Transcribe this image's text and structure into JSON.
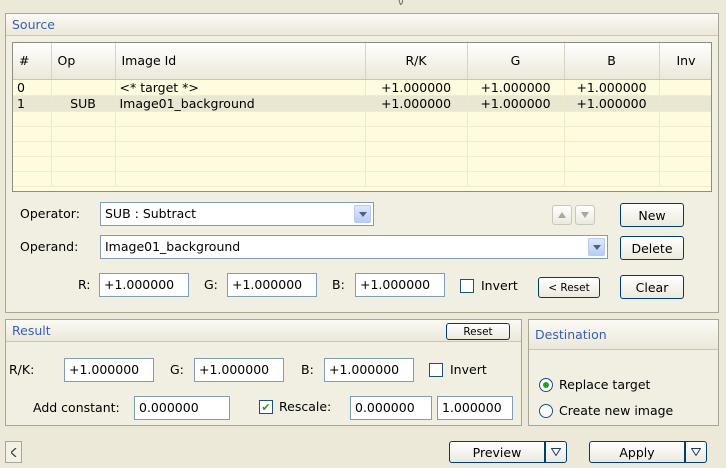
{
  "source": {
    "title": "Source",
    "columns": [
      "#",
      "Op",
      "Image Id",
      "R/K",
      "G",
      "B",
      "Inv"
    ],
    "rows": [
      {
        "num": "0",
        "op": "",
        "image_id": "<* target *>",
        "rk": "+1.000000",
        "g": "+1.000000",
        "b": "+1.000000",
        "inv": ""
      },
      {
        "num": "1",
        "op": "SUB",
        "image_id": "Image01_background",
        "rk": "+1.000000",
        "g": "+1.000000",
        "b": "+1.000000",
        "inv": ""
      }
    ],
    "operator_label": "Operator:",
    "operator_value": "SUB : Subtract",
    "operand_label": "Operand:",
    "operand_value": "Image01_background",
    "r_label": "R:",
    "r_value": "+1.000000",
    "g_label": "G:",
    "g_value": "+1.000000",
    "b_label": "B:",
    "b_value": "+1.000000",
    "invert_label": "Invert",
    "invert_checked": false,
    "reset_label": "< Reset",
    "new_label": "New",
    "delete_label": "Delete",
    "clear_label": "Clear",
    "up_icon": "arrow-up-icon",
    "down_icon": "arrow-down-icon"
  },
  "result": {
    "title": "Result",
    "reset_label": "Reset",
    "rk_label": "R/K:",
    "rk_value": "+1.000000",
    "g_label": "G:",
    "g_value": "+1.000000",
    "b_label": "B:",
    "b_value": "+1.000000",
    "invert_label": "Invert",
    "invert_checked": false,
    "add_constant_label": "Add constant:",
    "add_constant_value": "0.000000",
    "rescale_label": "Rescale:",
    "rescale_checked": true,
    "rescale_min": "0.000000",
    "rescale_max": "1.000000"
  },
  "destination": {
    "title": "Destination",
    "options": [
      "Replace target",
      "Create new image"
    ],
    "selected": "Replace target"
  },
  "footer": {
    "left_icon": "chevron-left-icon",
    "preview_label": "Preview",
    "apply_label": "Apply"
  },
  "colors": {
    "panel_title": "#3a5fb2",
    "grid_background": "#fffbdf",
    "window_background": "#ece9d8",
    "check_green": "#21a121"
  }
}
